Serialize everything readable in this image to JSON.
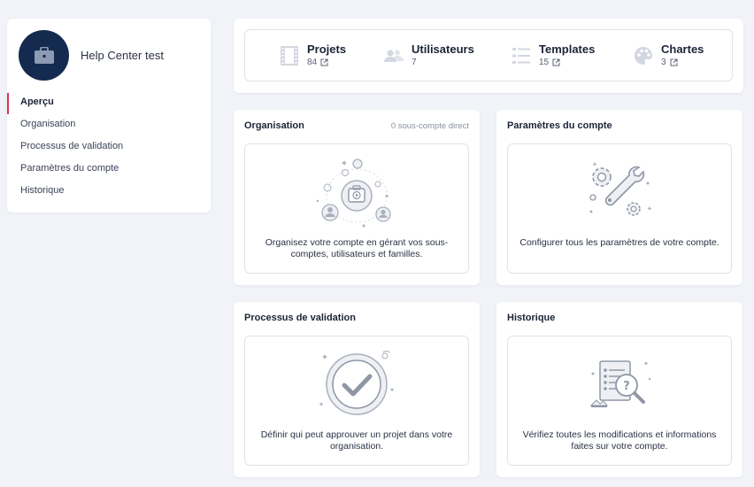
{
  "account": {
    "name": "Help Center test"
  },
  "nav": {
    "items": [
      {
        "label": "Aperçu"
      },
      {
        "label": "Organisation"
      },
      {
        "label": "Processus de validation"
      },
      {
        "label": "Paramètres du compte"
      },
      {
        "label": "Historique"
      }
    ]
  },
  "stats": {
    "projets": {
      "label": "Projets",
      "value": "84",
      "icon": "film-icon"
    },
    "utilisateurs": {
      "label": "Utilisateurs",
      "value": "7",
      "icon": "users-icon"
    },
    "templates": {
      "label": "Templates",
      "value": "15",
      "icon": "list-icon"
    },
    "chartes": {
      "label": "Chartes",
      "value": "3",
      "icon": "palette-icon"
    }
  },
  "panels": {
    "organisation": {
      "title": "Organisation",
      "meta": "0 sous-compte direct",
      "description": "Organisez votre compte en gérant vos sous-comptes, utilisateurs et familles."
    },
    "parametres": {
      "title": "Paramètres du compte",
      "description": "Configurer tous les paramètres de votre compte."
    },
    "validation": {
      "title": "Processus de validation",
      "description": "Définir qui peut approuver un projet dans votre organisation."
    },
    "historique": {
      "title": "Historique",
      "description": "Vérifiez toutes les modifications et informations faites sur votre compte."
    }
  },
  "colors": {
    "accent": "#e0334f",
    "avatar_bg": "#142a4f",
    "icon_gray": "#c9ced8"
  }
}
